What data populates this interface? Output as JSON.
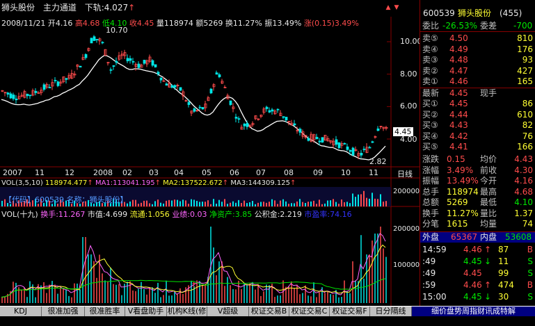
{
  "header": {
    "stock_name": "狮头股份",
    "indicator": "主力通道",
    "lower_rail": "下轨:4.027",
    "date": "2008/11/21",
    "open": "开4.16",
    "high": "高4.68",
    "low": "低4.10",
    "close": "收4.45",
    "volume": "量118974",
    "amount": "额5269",
    "turnover": "换11.27%",
    "amplitude": "振13.49%",
    "change": "涨(0.15)3.49%"
  },
  "price_axis": [
    "10.00",
    "8.00",
    "6.00",
    "4.00"
  ],
  "peak_label": "10.70",
  "trough_label": "2.82",
  "price_tag": "4.45",
  "time_axis": [
    "2007",
    "11",
    "12",
    "2008",
    "02",
    "03",
    "04",
    "05",
    "06",
    "07",
    "08",
    "09",
    "10",
    "11"
  ],
  "period_label": "日线",
  "vol_line": {
    "label": "VOL(3,5,10)",
    "v": "118974.477",
    "ma1": "MA1:113041.195",
    "ma2": "MA2:137522.672",
    "ma3": "MA3:144309.125",
    "axis": "200000"
  },
  "info_overlay": "【代码】600539  名称：狮头股份】",
  "lower_panel": {
    "title": "VOL(十九)",
    "turnover": "换手:11.267",
    "mkt_value": "市值:4.699",
    "float": "流通:1.056",
    "eps": "业绩:0.03",
    "nav": "净资产:3.85",
    "reserve": "公积金:2.219",
    "pe": "市盈率:74.16",
    "axis": [
      "200000",
      "100000"
    ]
  },
  "side": {
    "code": "600539",
    "name": "狮头股份",
    "count": "(455)",
    "wei_bi_label": "委比",
    "wei_bi": "-26.53%",
    "wei_cha_label": "委差",
    "wei_cha": "-700",
    "asks": [
      {
        "label": "卖⑤",
        "price": "4.50",
        "vol": "810"
      },
      {
        "label": "卖④",
        "price": "4.49",
        "vol": "176"
      },
      {
        "label": "卖③",
        "price": "4.48",
        "vol": "93"
      },
      {
        "label": "卖②",
        "price": "4.47",
        "vol": "427"
      },
      {
        "label": "卖①",
        "price": "4.46",
        "vol": "165"
      }
    ],
    "latest_label": "最新",
    "latest": "4.45",
    "hand_label": "现手",
    "hand": "",
    "bids": [
      {
        "label": "买①",
        "price": "4.45",
        "vol": "86"
      },
      {
        "label": "买②",
        "price": "4.44",
        "vol": "610"
      },
      {
        "label": "买③",
        "price": "4.43",
        "vol": "82"
      },
      {
        "label": "买④",
        "price": "4.42",
        "vol": "76"
      },
      {
        "label": "买⑤",
        "price": "4.41",
        "vol": "166"
      }
    ],
    "stats": [
      {
        "l1": "涨跌",
        "v1": "0.15",
        "l2": "均价",
        "v2": "4.43"
      },
      {
        "l1": "涨幅",
        "v1": "3.49%",
        "l2": "前收",
        "v2": "4.30"
      },
      {
        "l1": "振幅",
        "v1": "13.49%",
        "l2": "今开",
        "v2": "4.16"
      },
      {
        "l1": "总手",
        "v1": "118974",
        "l2": "最高",
        "v2": "4.68"
      },
      {
        "l1": "总额",
        "v1": "5269",
        "l2": "最低",
        "v2": "4.10"
      },
      {
        "l1": "换手",
        "v1": "11.27%",
        "l2": "量比",
        "v2": "1.37"
      },
      {
        "l1": "分笔",
        "v1": "1615",
        "l2": "均量",
        "v2": "74"
      }
    ],
    "outer_label": "外盘",
    "outer": "65367",
    "inner_label": "内盘",
    "inner": "53608",
    "ticks": [
      {
        "time": "14:59",
        "price": "4.46",
        "arrow": "↑",
        "vol": "87",
        "side": "B"
      },
      {
        "time": ":49",
        "price": "4.45",
        "arrow": "↓",
        "vol": "11",
        "side": "S"
      },
      {
        "time": ":49",
        "price": "4.45",
        "arrow": "",
        "vol": "99",
        "side": "S"
      },
      {
        "time": ":59",
        "price": "4.46",
        "arrow": "↑",
        "vol": "474",
        "side": "B"
      },
      {
        "time": "15:00",
        "price": "4.45",
        "arrow": "↓",
        "vol": "30",
        "side": "S"
      }
    ]
  },
  "tabs": [
    "KDJ",
    "很准加强",
    "很准胜率",
    "V看盘助手",
    "机构K线(修",
    "V超级MACD",
    "权证交易B",
    "权证交易C",
    "权证交易F",
    "日分隔线"
  ],
  "side_tabs": "细价盘势周指财讯成特解",
  "colors": {
    "up": "#ff4c4c",
    "down": "#00e600",
    "axis": "#800000",
    "bg": "#000000"
  }
}
